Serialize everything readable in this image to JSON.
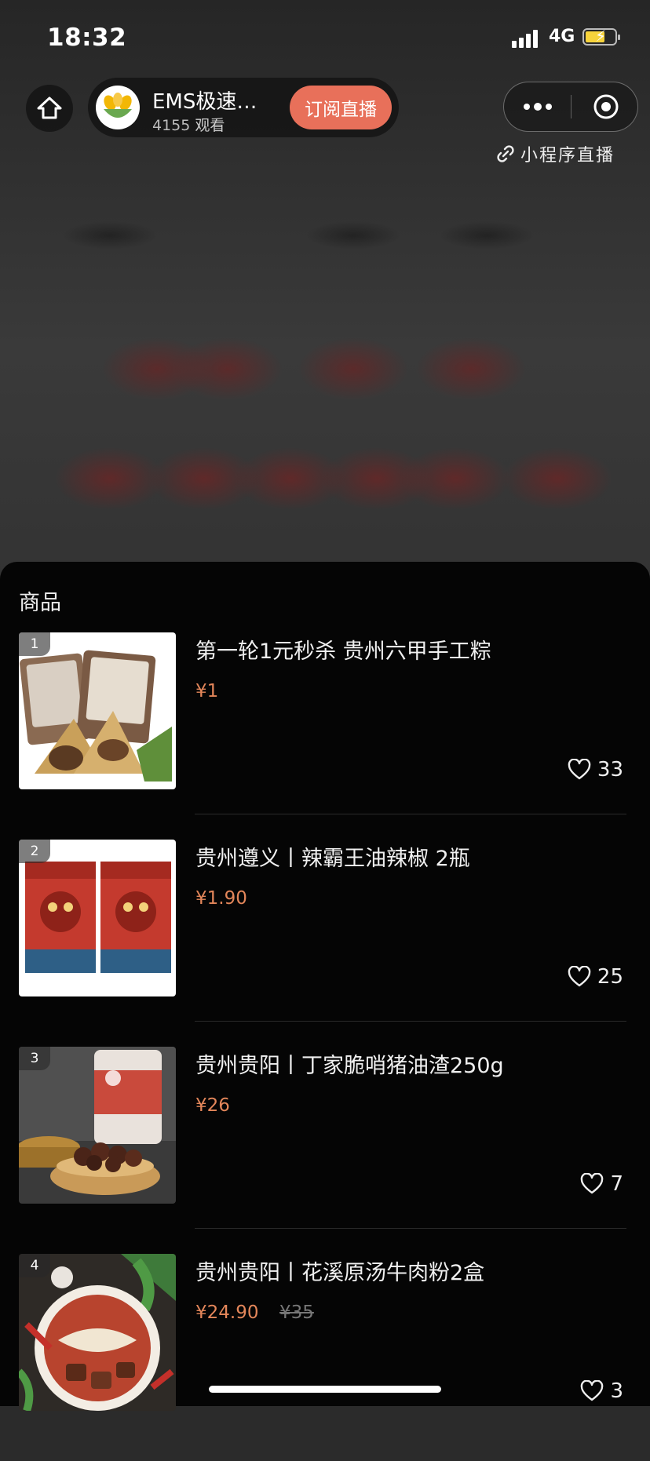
{
  "status_bar": {
    "time": "18:32",
    "network": "4G"
  },
  "live": {
    "anchor_name": "EMS极速…",
    "viewer_count": "4155",
    "viewer_unit": "观看",
    "subscribe_label": "订阅直播",
    "mini_program_label": "小程序直播"
  },
  "panel": {
    "title": "商品",
    "products": [
      {
        "rank": "1",
        "title": "第一轮1元秒杀 贵州六甲手工粽",
        "price": "¥1",
        "original_price": "",
        "likes": "33"
      },
      {
        "rank": "2",
        "title": "贵州遵义丨辣霸王油辣椒 2瓶",
        "price": "¥1.90",
        "original_price": "",
        "likes": "25"
      },
      {
        "rank": "3",
        "title": "贵州贵阳丨丁家脆哨猪油渣250g",
        "price": "¥26",
        "original_price": "",
        "likes": "7"
      },
      {
        "rank": "4",
        "title": "贵州贵阳丨花溪原汤牛肉粉2盒",
        "price": "¥24.90",
        "original_price": "¥35",
        "likes": "3"
      }
    ]
  },
  "colors": {
    "subscribe_bg": "#e8705a",
    "price": "#e3865a",
    "panel_bg": "#050505"
  }
}
